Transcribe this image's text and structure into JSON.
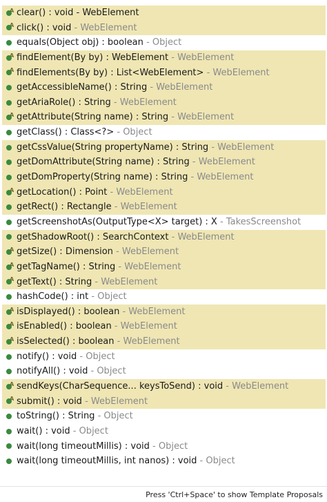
{
  "proposals": [
    {
      "signature": "clear() : void - WebElement",
      "owner": "",
      "abstract": true,
      "highlight": true
    },
    {
      "signature": "click() : void",
      "owner": "WebElement",
      "abstract": true,
      "highlight": true
    },
    {
      "signature": "equals(Object obj) : boolean",
      "owner": "Object",
      "abstract": false,
      "highlight": false
    },
    {
      "signature": "findElement(By by) : WebElement",
      "owner": "WebElement",
      "abstract": true,
      "highlight": true
    },
    {
      "signature": "findElements(By by) : List<WebElement>",
      "owner": "WebElement",
      "abstract": true,
      "highlight": true
    },
    {
      "signature": "getAccessibleName() : String",
      "owner": "WebElement",
      "abstract": false,
      "highlight": true
    },
    {
      "signature": "getAriaRole() : String",
      "owner": "WebElement",
      "abstract": false,
      "highlight": true
    },
    {
      "signature": "getAttribute(String name) : String",
      "owner": "WebElement",
      "abstract": true,
      "highlight": true
    },
    {
      "signature": "getClass() : Class<?>",
      "owner": "Object",
      "abstract": false,
      "highlight": false
    },
    {
      "signature": "getCssValue(String propertyName) : String",
      "owner": "WebElement",
      "abstract": false,
      "highlight": true
    },
    {
      "signature": "getDomAttribute(String name) : String",
      "owner": "WebElement",
      "abstract": false,
      "highlight": true
    },
    {
      "signature": "getDomProperty(String name) : String",
      "owner": "WebElement",
      "abstract": false,
      "highlight": true
    },
    {
      "signature": "getLocation() : Point",
      "owner": "WebElement",
      "abstract": true,
      "highlight": true
    },
    {
      "signature": "getRect() : Rectangle",
      "owner": "WebElement",
      "abstract": false,
      "highlight": true
    },
    {
      "signature": "getScreenshotAs(OutputType<X> target) : X",
      "owner": "TakesScreenshot",
      "abstract": false,
      "highlight": false
    },
    {
      "signature": "getShadowRoot() : SearchContext",
      "owner": "WebElement",
      "abstract": false,
      "highlight": true
    },
    {
      "signature": "getSize() : Dimension",
      "owner": "WebElement",
      "abstract": true,
      "highlight": true
    },
    {
      "signature": "getTagName() : String",
      "owner": "WebElement",
      "abstract": true,
      "highlight": true
    },
    {
      "signature": "getText() : String",
      "owner": "WebElement",
      "abstract": true,
      "highlight": true
    },
    {
      "signature": "hashCode() : int",
      "owner": "Object",
      "abstract": false,
      "highlight": false
    },
    {
      "signature": "isDisplayed() : boolean",
      "owner": "WebElement",
      "abstract": true,
      "highlight": true
    },
    {
      "signature": "isEnabled() : boolean",
      "owner": "WebElement",
      "abstract": true,
      "highlight": true
    },
    {
      "signature": "isSelected() : boolean",
      "owner": "WebElement",
      "abstract": true,
      "highlight": true
    },
    {
      "signature": "notify() : void",
      "owner": "Object",
      "abstract": false,
      "highlight": false
    },
    {
      "signature": "notifyAll() : void",
      "owner": "Object",
      "abstract": false,
      "highlight": false
    },
    {
      "signature": "sendKeys(CharSequence... keysToSend) : void",
      "owner": "WebElement",
      "abstract": true,
      "highlight": true
    },
    {
      "signature": "submit() : void",
      "owner": "WebElement",
      "abstract": true,
      "highlight": true
    },
    {
      "signature": "toString() : String",
      "owner": "Object",
      "abstract": false,
      "highlight": false
    },
    {
      "signature": "wait() : void",
      "owner": "Object",
      "abstract": false,
      "highlight": false
    },
    {
      "signature": "wait(long timeoutMillis) : void",
      "owner": "Object",
      "abstract": false,
      "highlight": false
    },
    {
      "signature": "wait(long timeoutMillis, int nanos) : void",
      "owner": "Object",
      "abstract": false,
      "highlight": false
    }
  ],
  "status": {
    "hint": "Press 'Ctrl+Space' to show Template Proposals"
  },
  "colors": {
    "highlight": "#efe6b4",
    "method_dot": "#3a8a3f",
    "owner_text": "#8a8a8a"
  },
  "icons": {
    "method": "public-method-icon",
    "abstract_marker": "abstract-marker-icon"
  }
}
